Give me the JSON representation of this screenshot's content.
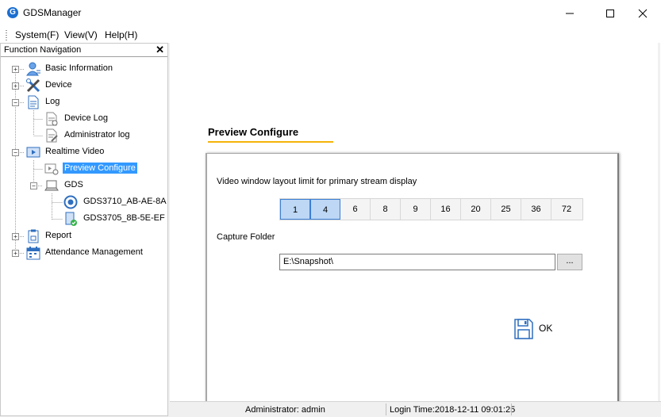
{
  "app": {
    "title": "GDSManager",
    "icon_letter": "G",
    "accent": "#1b6fd1"
  },
  "window_controls": {
    "minimize": "—",
    "maximize": "☐",
    "close": "✕"
  },
  "menu": [
    "System(F)",
    "View(V)",
    "Help(H)"
  ],
  "nav": {
    "title": "Function Navigation",
    "close": "✕",
    "items": [
      {
        "label": "Basic Information",
        "icon": "user-icon",
        "expander": "+"
      },
      {
        "label": "Device",
        "icon": "tools-icon",
        "expander": "+"
      },
      {
        "label": "Log",
        "icon": "document-icon",
        "expander": "−"
      },
      {
        "label": "Device Log",
        "icon": "device-log-icon"
      },
      {
        "label": "Administrator log",
        "icon": "admin-log-icon"
      },
      {
        "label": "Realtime Video",
        "icon": "video-play-icon",
        "expander": "−"
      },
      {
        "label": "Preview Configure",
        "icon": "video-config-icon",
        "selected": true
      },
      {
        "label": "GDS",
        "icon": "laptop-icon",
        "expander": "−"
      },
      {
        "label": "GDS3710_AB-AE-8A",
        "icon": "camera-icon"
      },
      {
        "label": "GDS3705_8B-5E-EF",
        "icon": "door-device-icon"
      },
      {
        "label": "Report",
        "icon": "clipboard-icon",
        "expander": "+"
      },
      {
        "label": "Attendance Management",
        "icon": "calendar-icon",
        "expander": "+"
      }
    ]
  },
  "main": {
    "section_title": "Preview Configure",
    "accent_underline": "#f5b40b",
    "layout_label": "Video window layout limit for primary stream display",
    "layout_options": [
      "1",
      "4",
      "6",
      "8",
      "9",
      "16",
      "20",
      "25",
      "36",
      "72"
    ],
    "layout_active": [
      "1",
      "4"
    ],
    "capture_label": "Capture Folder",
    "capture_path": "E:\\Snapshot\\",
    "browse_label": "...",
    "ok_label": "OK"
  },
  "status": {
    "user": "Administrator: admin",
    "login_time": "Login Time:2018-12-11 09:01:25"
  }
}
